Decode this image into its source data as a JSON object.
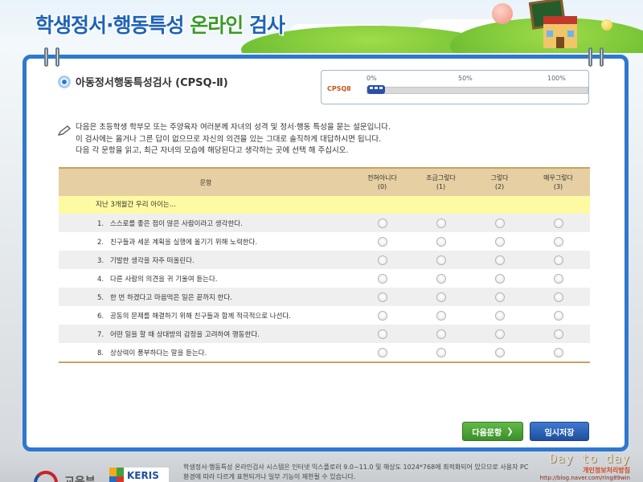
{
  "header": {
    "title_part1": "학생정서·행동특성",
    "title_part2": "온라인",
    "title_part3": "검사"
  },
  "test": {
    "title": "아동정서행동특성검사 (CPSQ-Ⅱ)"
  },
  "progress": {
    "label": "CPSQⅡ",
    "ticks": [
      "0%",
      "50%",
      "100%"
    ],
    "value_percent": 0
  },
  "instructions": [
    "다음은 초등학생 학부모 또는 주양육자 여러분께 자녀의 성격 및 정서·행동 특성을 묻는 설문입니다.",
    "이 검사에는 옳거나 그른 답이 없으므로 자신의 의견을 있는 그대로 솔직하게 대답하시면 됩니다.",
    "다음 각 문항을 읽고, 최근 자녀의 모습에 해당된다고 생각하는 곳에 선택 해 주십시오."
  ],
  "table": {
    "question_header": "문항",
    "options": [
      {
        "label": "전혀아니다",
        "code": "(0)"
      },
      {
        "label": "조금그렇다",
        "code": "(1)"
      },
      {
        "label": "그렇다",
        "code": "(2)"
      },
      {
        "label": "매우그렇다",
        "code": "(3)"
      }
    ],
    "subheading": "지난 3개월간 우리 아이는...",
    "questions": [
      {
        "num": "1.",
        "text": "스스로를 좋은 점이 많은 사람이라고 생각한다."
      },
      {
        "num": "2.",
        "text": "친구들과 세운 계획을 실행에 옮기기 위해 노력한다."
      },
      {
        "num": "3.",
        "text": "기발한 생각을 자주 떠올린다."
      },
      {
        "num": "4.",
        "text": "다른 사람의 의견을 귀 기울여 듣는다."
      },
      {
        "num": "5.",
        "text": "한 번 하겠다고 마음먹은 일은 끝까지 한다."
      },
      {
        "num": "6.",
        "text": "공동의 문제를 해결하기 위해 친구들과 함께 적극적으로 나선다."
      },
      {
        "num": "7.",
        "text": "어떤 일을 할 때 상대방의 감정을 고려하여 행동한다."
      },
      {
        "num": "8.",
        "text": "상상력이 풍부하다는 말을 듣는다."
      }
    ]
  },
  "buttons": {
    "next": "다음문항",
    "save": "임시저장"
  },
  "footer": {
    "moe_text": "교육부",
    "keris_text": "KERIS",
    "line1": "학생정서·행동특성 온라인검사 시스템은 인터넷 익스플로러 9.0~11.0 및 해상도 1024*768에 최적화되어 있으므로 사용자 PC",
    "line2": "환경에 따라 다르게 표현되거나 일부 기능이 제한될 수 있습니다."
  },
  "watermark": {
    "main": "Day to day",
    "sub": "개인정보처리방침",
    "url": "http://blog.naver.com/ring89win"
  },
  "colors": {
    "panel_border": "#2f78cf",
    "table_header": "#e6cfa2",
    "subheading_bg": "#fdfaa3",
    "next_button": "#4aa236",
    "save_button": "#2a60b4"
  }
}
